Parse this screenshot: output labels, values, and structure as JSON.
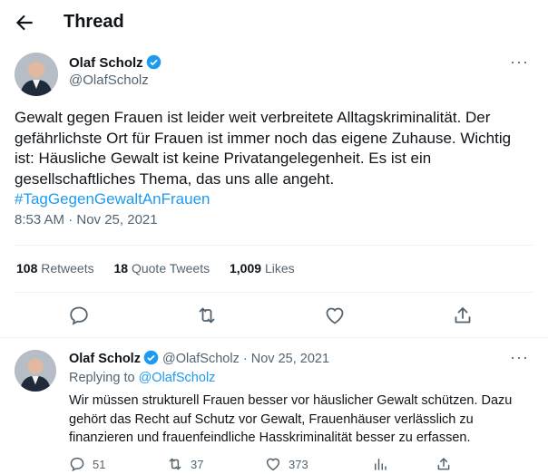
{
  "header": {
    "title": "Thread",
    "back_icon": "arrow-left-icon"
  },
  "tweet": {
    "author_name": "Olaf Scholz",
    "author_handle": "@OlafScholz",
    "text": "Gewalt gegen Frauen ist leider weit verbreitete Alltagskriminalität. Der gefährlichste Ort für Frauen ist immer noch das eigene Zuhause. Wichtig ist: Häusliche Gewalt ist keine Privatangelegenheit. Es ist ein gesellschaftliches Thema, das uns alle angeht.",
    "hashtag": "#TagGegenGewaltAnFrauen",
    "timestamp": "8:53 AM · Nov 25, 2021",
    "stats": {
      "retweets_count": "108",
      "retweets_label": "Retweets",
      "quotes_count": "18",
      "quotes_label": "Quote Tweets",
      "likes_count": "1,009",
      "likes_label": "Likes"
    },
    "more": "···"
  },
  "reply": {
    "author_name": "Olaf Scholz",
    "author_handle": "@OlafScholz",
    "date": "Nov 25, 2021",
    "separator": "·",
    "replying_label": "Replying to",
    "replying_handle": "@OlafScholz",
    "text": "Wir müssen strukturell Frauen besser vor häuslicher Gewalt schützen. Dazu gehört das Recht auf Schutz vor Gewalt, Frauenhäuser verlässlich zu finanzieren und frauenfeindliche Hasskriminalität besser zu erfassen.",
    "replies": "51",
    "retweets": "37",
    "likes": "373",
    "more": "···"
  },
  "colors": {
    "accent": "#1d9bf0",
    "muted": "#536471",
    "divider": "#eff3f4"
  }
}
